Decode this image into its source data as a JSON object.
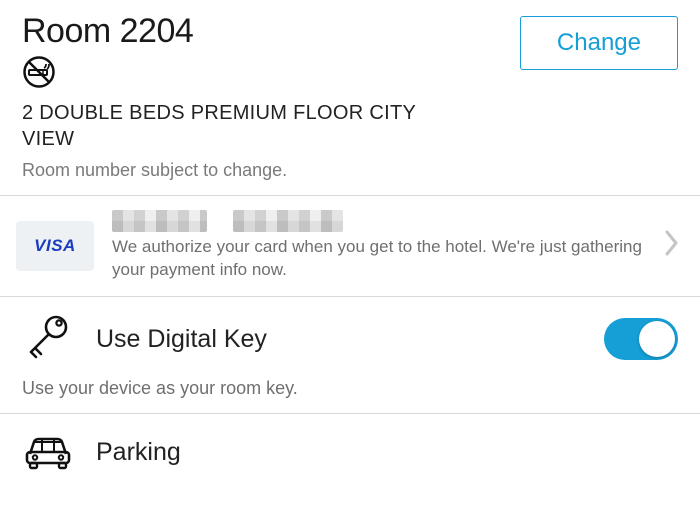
{
  "room": {
    "title": "Room 2204",
    "change_label": "Change",
    "description": "2 DOUBLE BEDS PREMIUM FLOOR CITY VIEW",
    "note": "Room number subject to change."
  },
  "payment": {
    "card_brand": "VISA",
    "note": "We authorize your card when you get to the hotel. We're just gathering your payment info now."
  },
  "digital_key": {
    "label": "Use Digital Key",
    "sub": "Use your device as your room key.",
    "enabled": true
  },
  "parking": {
    "label": "Parking"
  },
  "colors": {
    "accent": "#159fd6"
  }
}
